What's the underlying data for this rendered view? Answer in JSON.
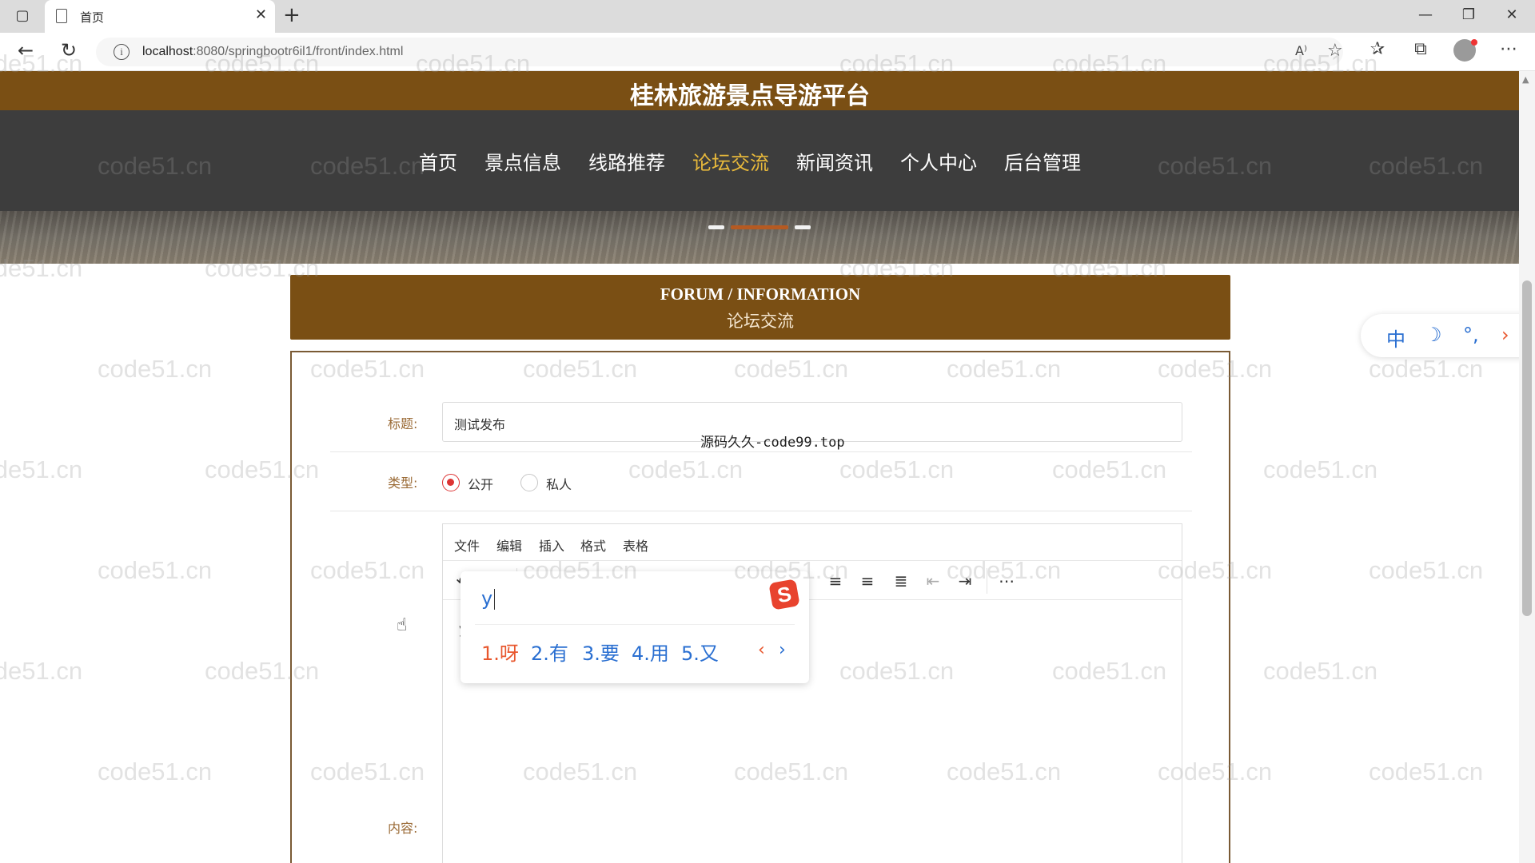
{
  "browser": {
    "tab_title": "首页",
    "url_host": "localhost",
    "url_rest": ":8080/springbootr6il1/front/index.html",
    "read_aloud_label": "A⁾"
  },
  "site": {
    "title": "桂林旅游景点导游平台",
    "nav": [
      {
        "label": "首页"
      },
      {
        "label": "景点信息"
      },
      {
        "label": "线路推荐"
      },
      {
        "label": "论坛交流"
      },
      {
        "label": "新闻资讯"
      },
      {
        "label": "个人中心"
      },
      {
        "label": "后台管理"
      }
    ],
    "active_nav": "论坛交流"
  },
  "forum": {
    "heading_en": "FORUM / INFORMATION",
    "heading_cn": "论坛交流"
  },
  "form": {
    "title_label": "标题:",
    "title_value": "测试发布",
    "type_label": "类型:",
    "type_options": [
      "公开",
      "私人"
    ],
    "type_selected": "公开",
    "content_label": "内容:",
    "editor_menu": [
      "文件",
      "编辑",
      "插入",
      "格式",
      "表格"
    ],
    "typed_text": "y"
  },
  "ime": {
    "composition": "y",
    "logo": "S",
    "candidates": [
      "1.呀",
      "2.有",
      "3.要",
      "4.用",
      "5.又"
    ],
    "prev": "‹",
    "next": "›",
    "status": [
      "中",
      "☽",
      "°,",
      "›"
    ]
  },
  "overlay": {
    "code99_text": "源码久久-code99.top",
    "watermark": "code51.cn"
  },
  "colors": {
    "brand_brown": "#7a4f14",
    "nav_dark": "#3d3d3d",
    "nav_active": "#e8b93b",
    "radio_checked": "#d33",
    "ime_blue": "#2a6fd1",
    "ime_orange": "#e8572e"
  },
  "icons": {
    "toolbar": [
      "undo-icon",
      "redo-icon",
      "text-color-icon",
      "highlight-icon",
      "bold-icon",
      "italic-icon",
      "underline-icon",
      "strikethrough-icon",
      "bullet-list-icon",
      "align-left-icon",
      "align-center-icon",
      "align-right-icon",
      "align-justify-icon",
      "outdent-icon",
      "indent-icon",
      "more-icon",
      "image-icon",
      "table-icon"
    ]
  }
}
